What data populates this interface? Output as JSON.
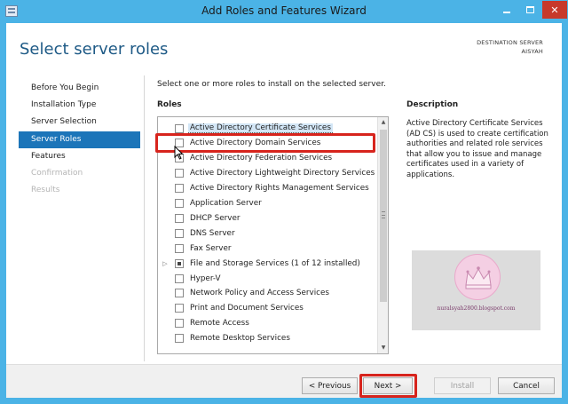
{
  "window": {
    "title": "Add Roles and Features Wizard",
    "close_glyph": "✕"
  },
  "header": {
    "page_title": "Select server roles",
    "destination_label": "DESTINATION SERVER",
    "destination_name": "AISYAH"
  },
  "nav": {
    "items": [
      {
        "label": "Before You Begin",
        "state": "normal"
      },
      {
        "label": "Installation Type",
        "state": "normal"
      },
      {
        "label": "Server Selection",
        "state": "normal"
      },
      {
        "label": "Server Roles",
        "state": "active"
      },
      {
        "label": "Features",
        "state": "normal"
      },
      {
        "label": "Confirmation",
        "state": "disabled"
      },
      {
        "label": "Results",
        "state": "disabled"
      }
    ]
  },
  "main": {
    "instruction": "Select one or more roles to install on the selected server.",
    "roles_heading": "Roles",
    "roles": [
      {
        "label": "Active Directory Certificate Services",
        "checked": false,
        "selected": true
      },
      {
        "label": "Active Directory Domain Services",
        "checked": false
      },
      {
        "label": "Active Directory Federation Services",
        "checked": false
      },
      {
        "label": "Active Directory Lightweight Directory Services",
        "checked": false
      },
      {
        "label": "Active Directory Rights Management Services",
        "checked": false
      },
      {
        "label": "Application Server",
        "checked": false
      },
      {
        "label": "DHCP Server",
        "checked": false
      },
      {
        "label": "DNS Server",
        "checked": false
      },
      {
        "label": "Fax Server",
        "checked": false
      },
      {
        "label": "File and Storage Services (1 of 12 installed)",
        "checked": "partial",
        "expandable": true
      },
      {
        "label": "Hyper-V",
        "checked": false
      },
      {
        "label": "Network Policy and Access Services",
        "checked": false
      },
      {
        "label": "Print and Document Services",
        "checked": false
      },
      {
        "label": "Remote Access",
        "checked": false
      },
      {
        "label": "Remote Desktop Services",
        "checked": false
      }
    ],
    "description_heading": "Description",
    "description_text": "Active Directory Certificate Services (AD CS) is used to create certification authorities and related role services that allow you to issue and manage certificates used in a variety of applications."
  },
  "watermark": {
    "text": "nuralsyah2800.blogspot.com"
  },
  "footer": {
    "previous_label": "< Previous",
    "next_label": "Next >",
    "install_label": "Install",
    "cancel_label": "Cancel"
  },
  "colors": {
    "titlebar": "#4bb3e6",
    "accent": "#1c75b9",
    "highlight_red": "#d7241d",
    "close_red": "#c7392b"
  }
}
